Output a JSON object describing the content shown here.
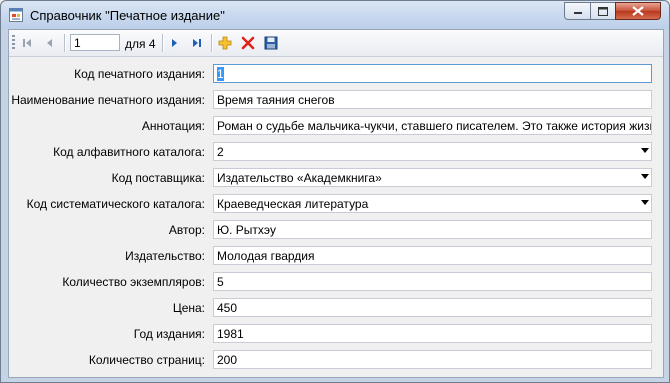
{
  "window": {
    "title": "Справочник \"Печатное издание\""
  },
  "toolbar": {
    "position_value": "1",
    "count_label": "для 4",
    "buttons": [
      "first-icon",
      "prev-icon",
      "next-icon",
      "last-icon",
      "add-icon",
      "delete-icon",
      "save-icon"
    ]
  },
  "form": {
    "fields": [
      {
        "label": "Код печатного издания:",
        "value": "1",
        "type": "text"
      },
      {
        "label": "Наименование печатного издания:",
        "value": "Время таяния снегов",
        "type": "text"
      },
      {
        "label": "Аннотация:",
        "value": "Роман о судьбе мальчика-чукчи, ставшего писателем. Это также история жизни мно",
        "type": "text"
      },
      {
        "label": "Код алфавитного каталога:",
        "value": "2",
        "type": "combo"
      },
      {
        "label": "Код поставщика:",
        "value": "Издательство «Академкнига»",
        "type": "combo"
      },
      {
        "label": "Код систематического каталога:",
        "value": "Краеведческая литература",
        "type": "combo"
      },
      {
        "label": "Автор:",
        "value": "Ю. Рытхэу",
        "type": "text"
      },
      {
        "label": "Издательство:",
        "value": "Молодая гвардия",
        "type": "text"
      },
      {
        "label": "Количество экземпляров:",
        "value": "5",
        "type": "text"
      },
      {
        "label": "Цена:",
        "value": "450",
        "type": "text"
      },
      {
        "label": "Год издания:",
        "value": "1981",
        "type": "text"
      },
      {
        "label": "Количество страниц:",
        "value": "200",
        "type": "text"
      }
    ]
  },
  "colors": {
    "selection": "#3399ff",
    "focus_border": "#5b9bd5",
    "close_button": "#c75038"
  }
}
